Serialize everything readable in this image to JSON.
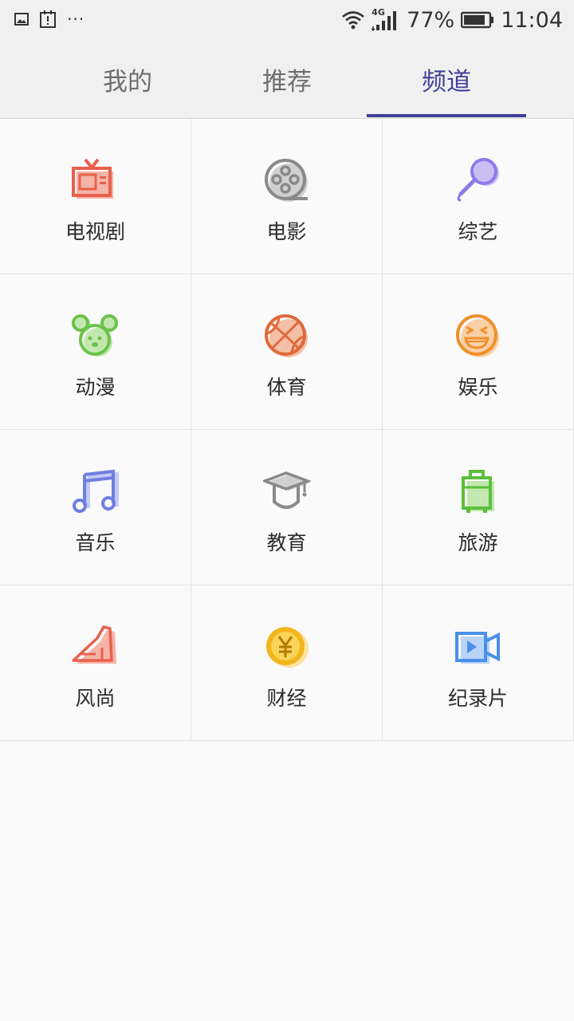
{
  "status_bar": {
    "battery_percent": "77%",
    "time": "11:04",
    "network_type": "4G",
    "left_icons": [
      "image-icon",
      "notification-icon",
      "more-dots-icon"
    ],
    "right_icons": [
      "wifi-icon",
      "cellular-signal-icon",
      "battery-icon"
    ]
  },
  "tabs": [
    {
      "label": "我的",
      "active": false
    },
    {
      "label": "推荐",
      "active": false
    },
    {
      "label": "频道",
      "active": true
    }
  ],
  "accent_color": "#3f3f9a",
  "channels": [
    {
      "label": "电视剧",
      "icon": "tv-icon",
      "color": "#e8604c"
    },
    {
      "label": "电影",
      "icon": "film-reel-icon",
      "color": "#8a8a8a"
    },
    {
      "label": "综艺",
      "icon": "microphone-icon",
      "color": "#8d79e8"
    },
    {
      "label": "动漫",
      "icon": "mouse-head-icon",
      "color": "#6cc24a"
    },
    {
      "label": "体育",
      "icon": "basketball-icon",
      "color": "#e06a3a"
    },
    {
      "label": "娱乐",
      "icon": "laughing-face-icon",
      "color": "#f0902a"
    },
    {
      "label": "音乐",
      "icon": "music-note-icon",
      "color": "#6f7ee0"
    },
    {
      "label": "教育",
      "icon": "graduation-cap-icon",
      "color": "#8a8a8a"
    },
    {
      "label": "旅游",
      "icon": "luggage-icon",
      "color": "#5cbf3c"
    },
    {
      "label": "风尚",
      "icon": "high-heel-icon",
      "color": "#e8604c"
    },
    {
      "label": "财经",
      "icon": "yen-coin-icon",
      "color": "#f2b51c"
    },
    {
      "label": "纪录片",
      "icon": "video-camera-icon",
      "color": "#4a90e8"
    }
  ]
}
